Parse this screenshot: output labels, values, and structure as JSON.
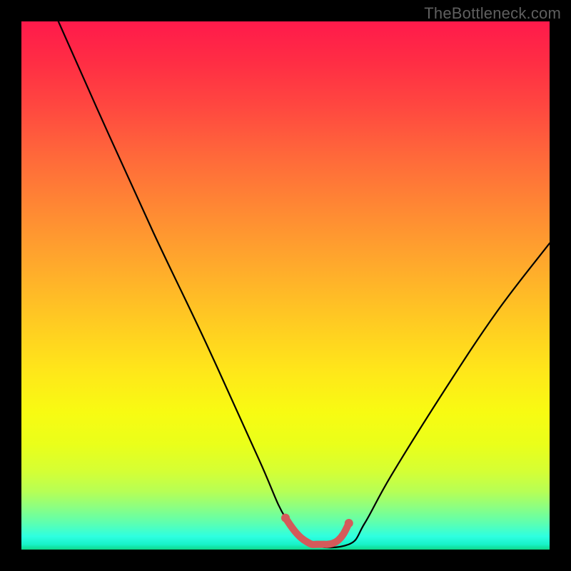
{
  "watermark": "TheBottleneck.com",
  "chart_data": {
    "type": "line",
    "title": "",
    "xlabel": "",
    "ylabel": "",
    "xlim": [
      0,
      100
    ],
    "ylim": [
      0,
      100
    ],
    "series": [
      {
        "name": "main-curve",
        "color": "#000000",
        "x": [
          7,
          15,
          25,
          35,
          45,
          50,
          55,
          62,
          65,
          70,
          80,
          90,
          100
        ],
        "y": [
          100,
          82,
          60,
          39,
          17,
          6,
          1,
          1,
          5,
          14,
          30,
          45,
          58
        ]
      },
      {
        "name": "highlight-segment",
        "color": "#d45a5a",
        "x": [
          50,
          51,
          52,
          53,
          54,
          55,
          56,
          57,
          58,
          59,
          60,
          61,
          62
        ],
        "y": [
          6,
          4.5,
          3.2,
          2.2,
          1.5,
          1,
          1,
          1,
          1,
          1.2,
          1.8,
          3,
          5
        ]
      }
    ],
    "background_gradient": {
      "top": "#ff1a4b",
      "mid_upper": "#ff8a33",
      "mid": "#ffe61a",
      "mid_lower": "#b7ff55",
      "bottom": "#0fd888"
    }
  }
}
